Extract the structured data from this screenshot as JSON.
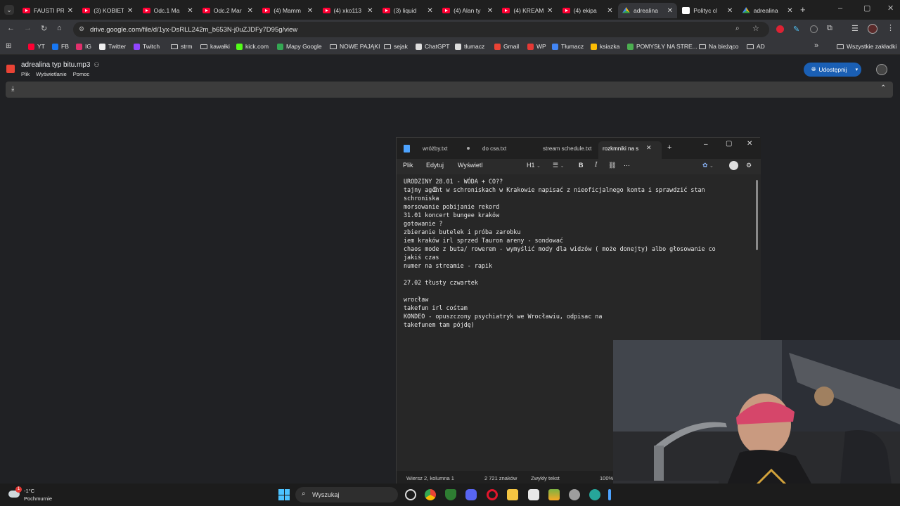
{
  "browser": {
    "tabs": [
      {
        "title": "FAUSTI PR",
        "kind": "yt"
      },
      {
        "title": "(3) KOBIET",
        "kind": "yt"
      },
      {
        "title": "Odc.1 Ma",
        "kind": "yt"
      },
      {
        "title": "Odc.2 Mar",
        "kind": "yt"
      },
      {
        "title": "(4) Mamm",
        "kind": "yt"
      },
      {
        "title": "(4) xko113",
        "kind": "yt"
      },
      {
        "title": "(3) liquid",
        "kind": "yt"
      },
      {
        "title": "(4) Alan ty",
        "kind": "yt"
      },
      {
        "title": "(4) KREAM",
        "kind": "yt"
      },
      {
        "title": "(4) ekipa",
        "kind": "yt"
      },
      {
        "title": "adrealina",
        "kind": "drive"
      },
      {
        "title": "Polityc cl",
        "kind": "b"
      },
      {
        "title": "adrealina",
        "kind": "drive"
      }
    ],
    "new_tab": "+",
    "url": "drive.google.com/file/d/1yx-DsRLL242m_b653N-j0uZJDFy7D95g/view",
    "bookmarks": [
      "YT",
      "FB",
      "IG",
      "Twitter",
      "Twitch",
      "strm",
      "kawałki",
      "kick.com",
      "Mapy Google",
      "NOWE PAJĄKI",
      "sejak",
      "ChatGPT",
      "tłumacz",
      "Gmail",
      "WP",
      "Tłumacz",
      "ksiazka",
      "POMYSŁY NA STRE...",
      "Na bieżąco",
      "AD"
    ],
    "bookmarks_more": "»",
    "all_bookmarks": "Wszystkie zakładki"
  },
  "drive": {
    "file_name": "adrealina typ bitu.mp3",
    "menu": [
      "Plik",
      "Wyświetlanie",
      "Pomoc"
    ],
    "share_label": "Udostępnij"
  },
  "notepad": {
    "tabs": [
      "wróżby.txt",
      "do csa.txt",
      "stream schedule.txt",
      "rozkmniki na s"
    ],
    "menu": [
      "Plik",
      "Edytuj",
      "Wyświetl"
    ],
    "heading_label": "H1",
    "lines": [
      "URODZINY 28.01 - WÓDA + CO??",
      "tajny agent w schroniskach w Krakowie napisać z nieoficjalnego konta i sprawdzić stan",
      "schroniska",
      "morsowanie pobijanie rekord",
      "31.01 koncert bungee kraków",
      "gotowanie ?",
      "zbieranie butelek i próba zarobku",
      "iem kraków irl sprzed Tauron areny - sondować",
      "chaos mode z buta/ rowerem - wymyślić mody dla widzów ( może donejty) albo głosowanie co",
      "jakiś czas",
      "numer na streamie - rapik",
      "",
      "27.02 tłusty czwartek",
      "",
      "wrocław",
      "takefun irl cośtam",
      "KONDEO - opuszczony psychiatryk we Wrocławiu, odpisac na",
      "takefunem tam pójdę)"
    ],
    "status": {
      "position": "Wiersz 2, kolumna 1",
      "chars": "2 721 znaków",
      "format": "Zwykły tekst",
      "zoom": "100%"
    }
  },
  "taskbar": {
    "weather_temp": "-1°C",
    "weather_desc": "Pochmurnie",
    "search_label": "Wyszukaj",
    "weather_badge": "1"
  },
  "colors": {
    "accent": "#1a5fb4",
    "youtube": "#ff0033",
    "drive_red": "#ea4335"
  }
}
